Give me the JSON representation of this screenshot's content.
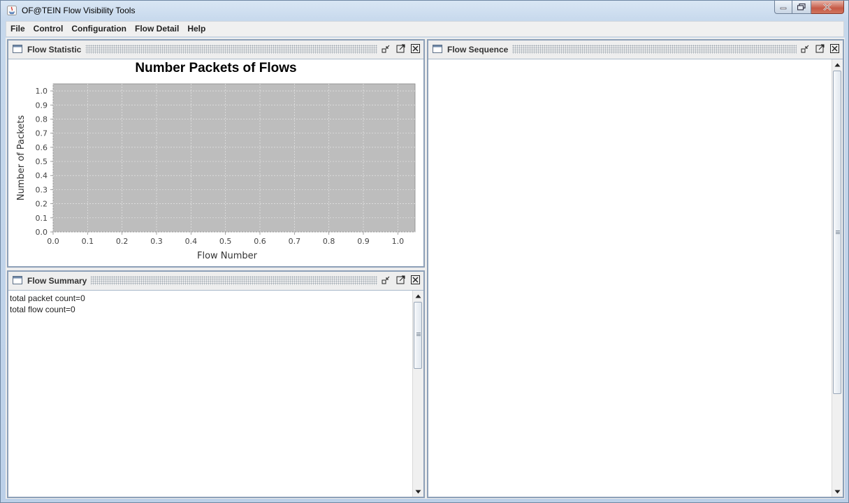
{
  "window": {
    "title": "OF@TEIN Flow Visibility Tools",
    "icons": [
      "java-app-icon",
      "minimize-icon",
      "maximize-icon",
      "close-icon"
    ]
  },
  "menubar": {
    "items": [
      {
        "label": "File"
      },
      {
        "label": "Control"
      },
      {
        "label": "Configuration"
      },
      {
        "label": "Flow Detail"
      },
      {
        "label": "Help"
      }
    ]
  },
  "panels": {
    "flow_statistic": {
      "title": "Flow Statistic"
    },
    "flow_summary": {
      "title": "Flow Summary",
      "lines": [
        "total packet count=0",
        "total flow count=0"
      ]
    },
    "flow_sequence": {
      "title": "Flow Sequence"
    }
  },
  "chart_data": {
    "type": "scatter",
    "title": "Number Packets of Flows",
    "xlabel": "Flow Number",
    "ylabel": "Number of Packets",
    "x_ticks": [
      "0.0",
      "0.1",
      "0.2",
      "0.3",
      "0.4",
      "0.5",
      "0.6",
      "0.7",
      "0.8",
      "0.9",
      "1.0"
    ],
    "y_ticks": [
      "0.0",
      "0.1",
      "0.2",
      "0.3",
      "0.4",
      "0.5",
      "0.6",
      "0.7",
      "0.8",
      "0.9",
      "1.0"
    ],
    "xlim": [
      0,
      1.05
    ],
    "ylim": [
      0,
      1.05
    ],
    "series": [],
    "grid": true,
    "plot_background": "#bdbdbd",
    "grid_color": "#e6e6e6"
  }
}
